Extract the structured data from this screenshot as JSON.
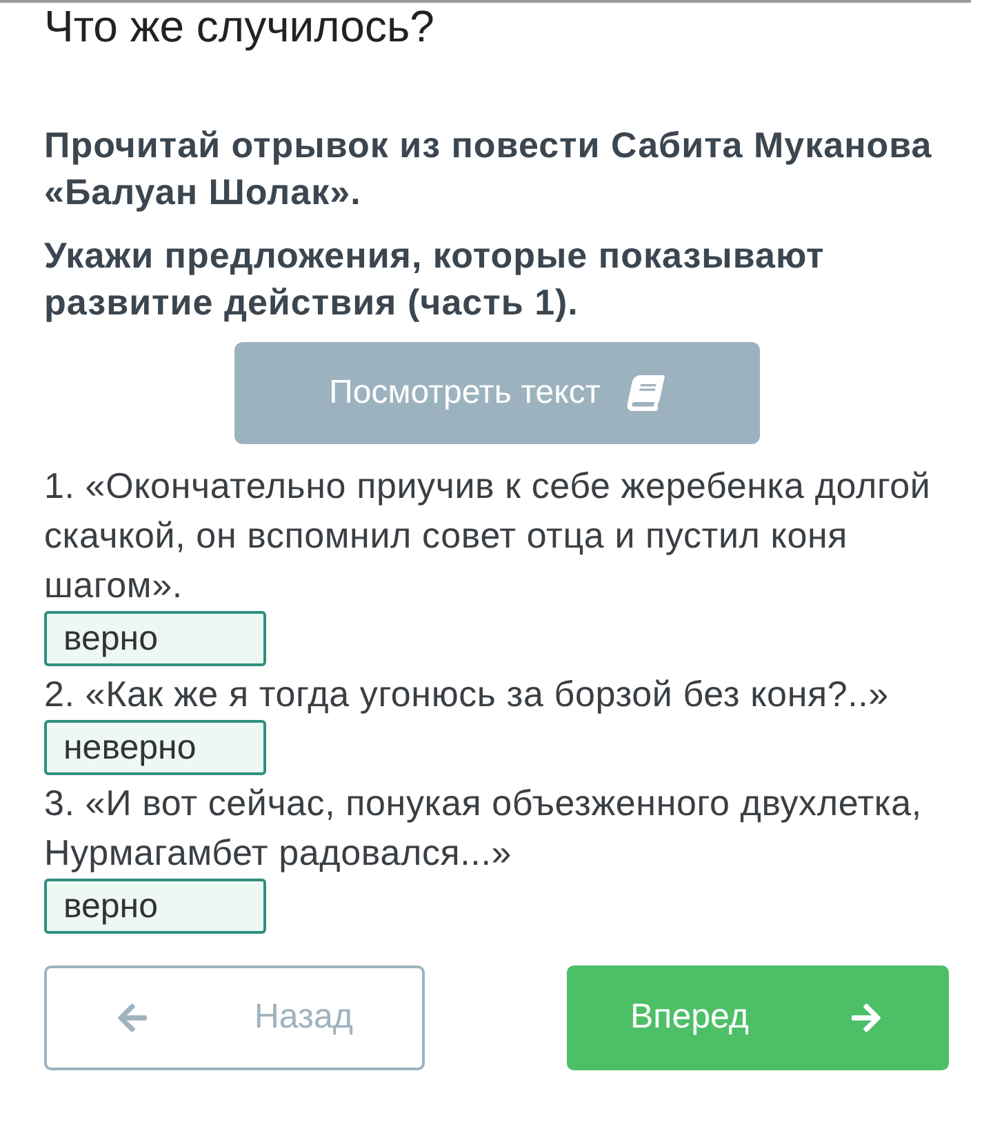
{
  "title": "Что же случилось?",
  "instructions": [
    "Прочитай отрывок из повести Сабита Муканова «Балуан Шолак».",
    "Укажи предложения, которые показывают развитие действия (часть 1)."
  ],
  "view_text_button": {
    "label": "Посмотреть текст"
  },
  "statements": [
    {
      "text": "1. «Окончательно приучив к себе жеребенка долгой скачкой, он вспомнил совет отца и пустил коня шагом».",
      "answer": "верно"
    },
    {
      "text": "2. «Как же я тогда угонюсь за борзой без коня?..»",
      "answer": "неверно"
    },
    {
      "text": "3. «И вот сейчас, понукая объезженного двухлетка, Нурмагамбет радовался...»",
      "answer": "верно"
    }
  ],
  "navigation": {
    "back": {
      "label": "Назад",
      "disabled": true
    },
    "next": {
      "label": "Вперед",
      "disabled": false
    }
  }
}
